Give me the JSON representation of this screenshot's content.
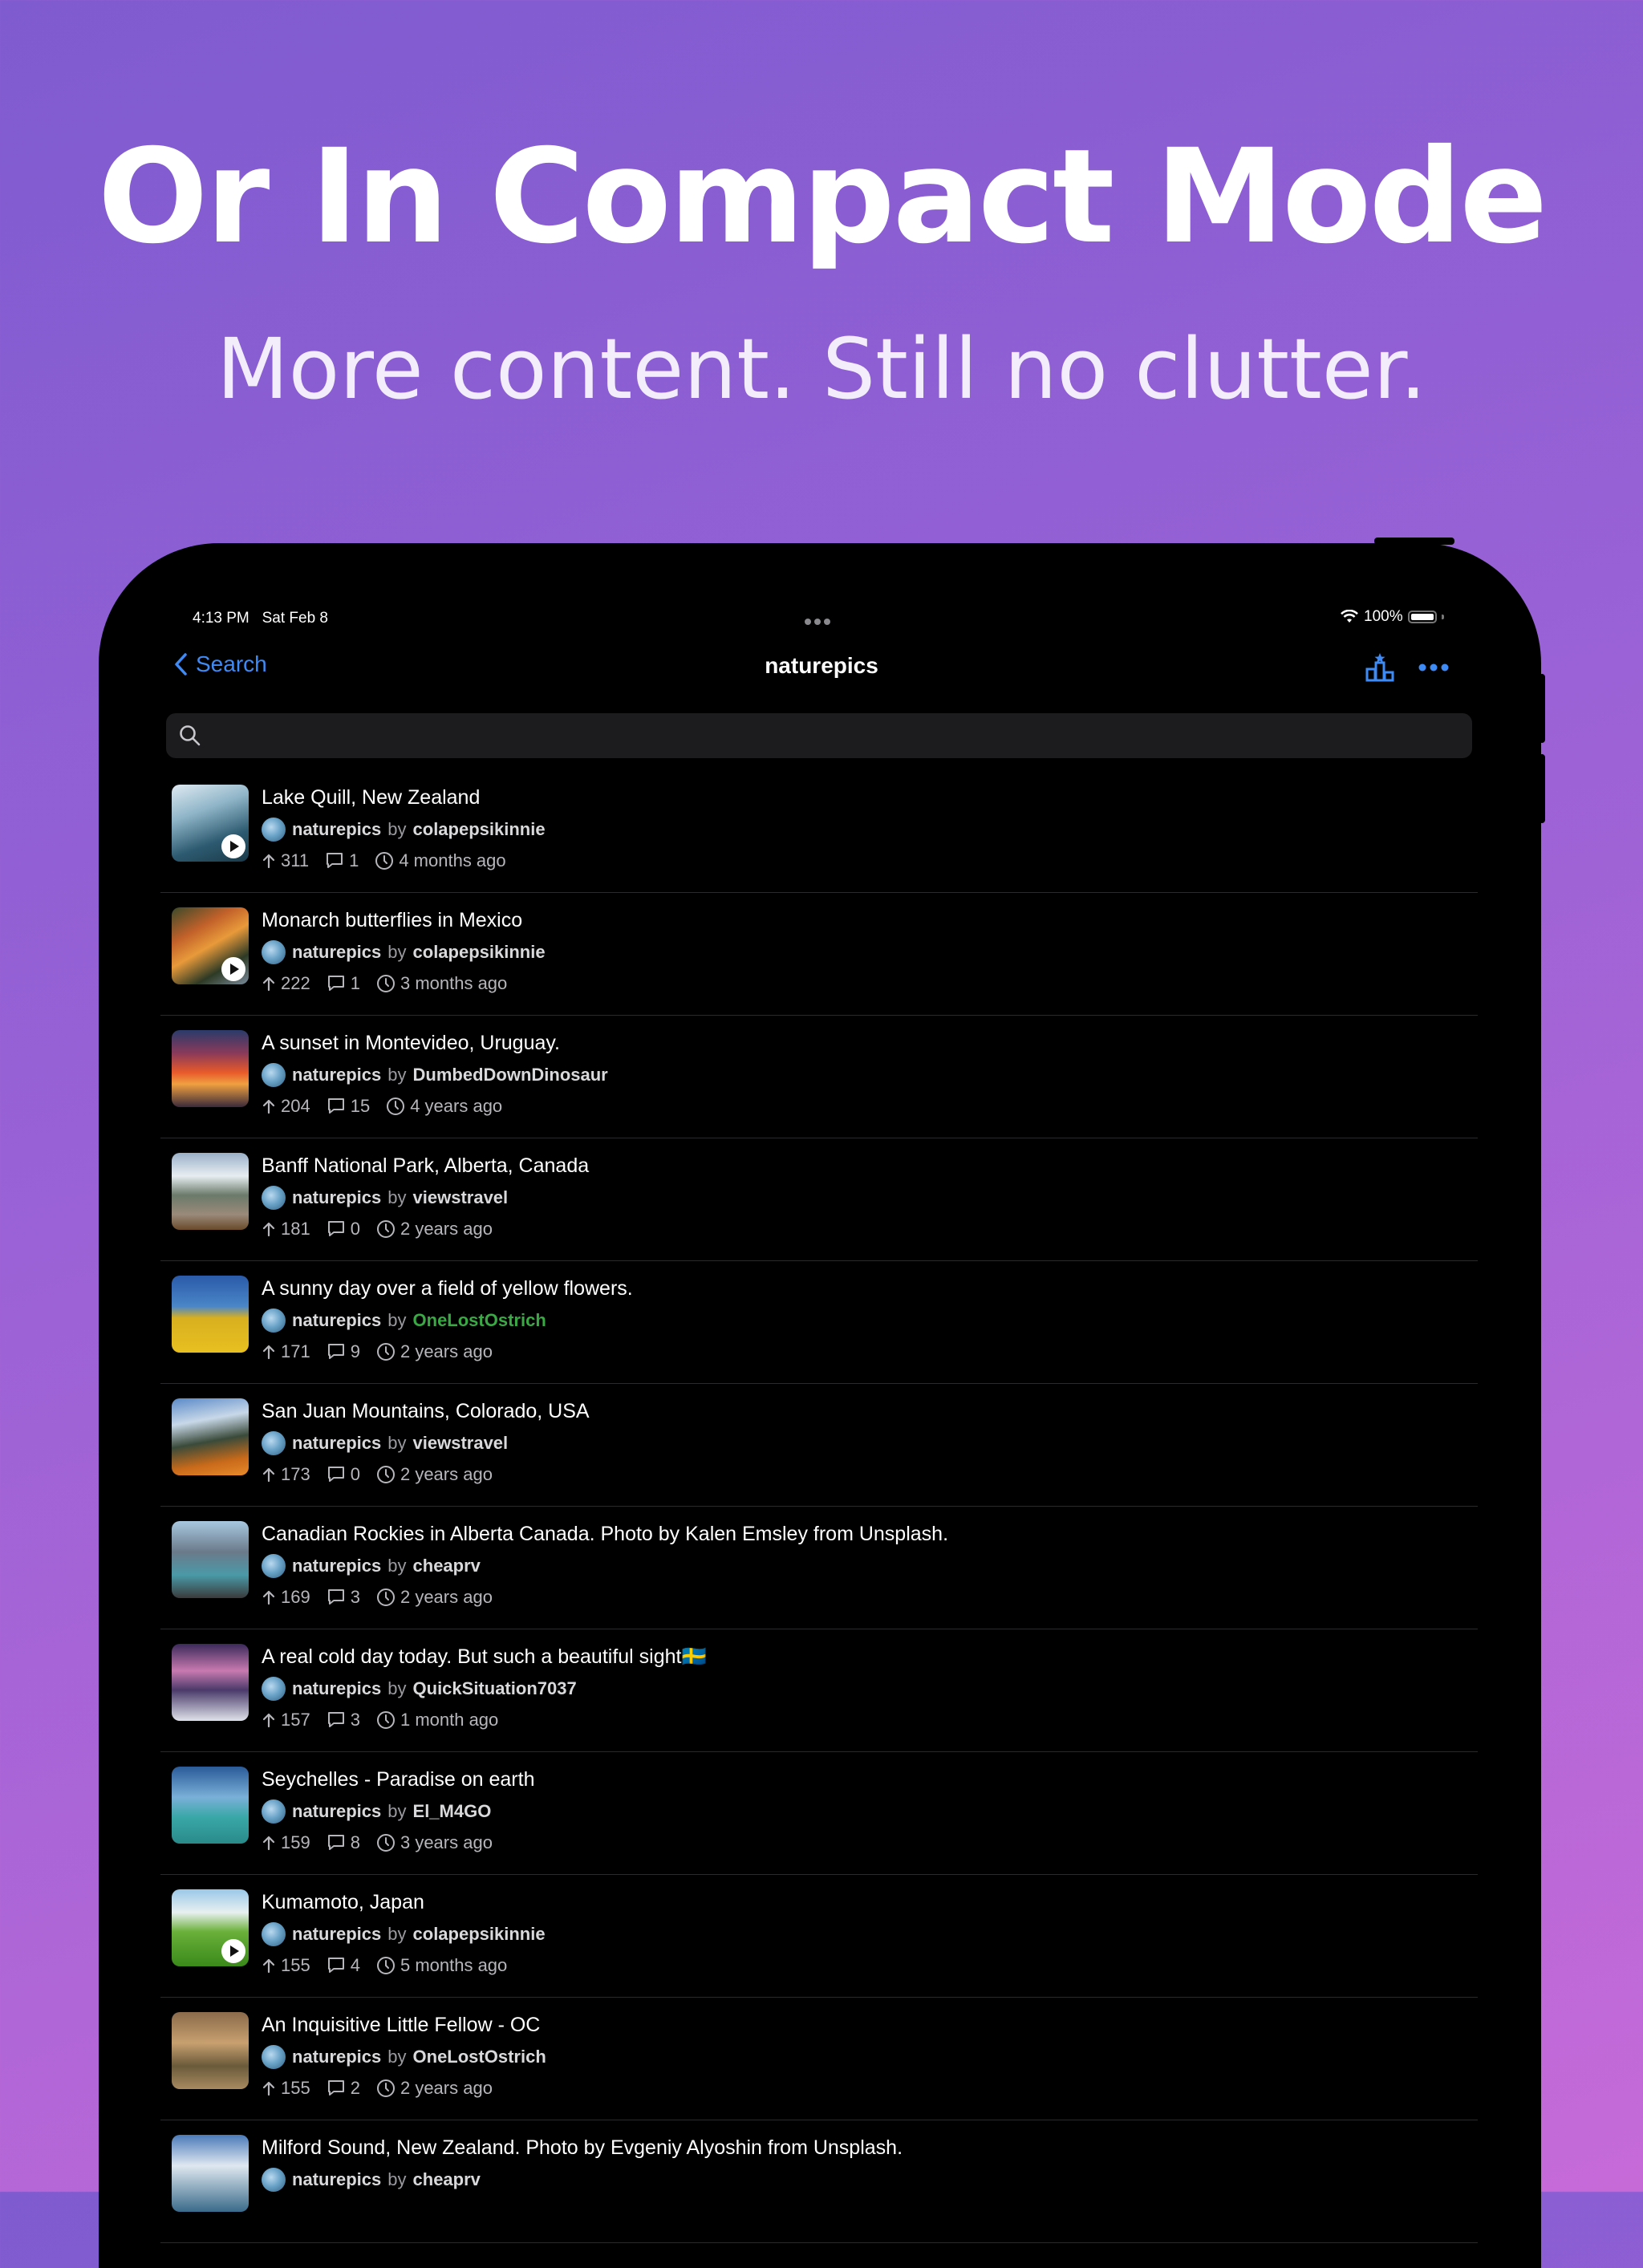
{
  "hero": {
    "title": "Or In Compact Mode",
    "subtitle": "More content. Still no clutter."
  },
  "status_bar": {
    "time": "4:13 PM",
    "date": "Sat Feb 8",
    "battery": "100%"
  },
  "nav": {
    "back_label": "Search",
    "title": "naturepics"
  },
  "search": {
    "value": "",
    "placeholder": ""
  },
  "by_label": "by",
  "posts": [
    {
      "title": "Lake Quill, New Zealand",
      "subreddit": "naturepics",
      "author": "colapepsikinnie",
      "upvotes": "311",
      "comments": "1",
      "age": "4 months ago",
      "video": true,
      "author_color": "default"
    },
    {
      "title": "Monarch butterflies in Mexico",
      "subreddit": "naturepics",
      "author": "colapepsikinnie",
      "upvotes": "222",
      "comments": "1",
      "age": "3 months ago",
      "video": true,
      "author_color": "default"
    },
    {
      "title": "A sunset in Montevideo, Uruguay.",
      "subreddit": "naturepics",
      "author": "DumbedDownDinosaur",
      "upvotes": "204",
      "comments": "15",
      "age": "4 years ago",
      "video": false,
      "author_color": "default"
    },
    {
      "title": "Banff National Park, Alberta, Canada",
      "subreddit": "naturepics",
      "author": "viewstravel",
      "upvotes": "181",
      "comments": "0",
      "age": "2 years ago",
      "video": false,
      "author_color": "default"
    },
    {
      "title": "A sunny day over a field of yellow flowers.",
      "subreddit": "naturepics",
      "author": "OneLostOstrich",
      "upvotes": "171",
      "comments": "9",
      "age": "2 years ago",
      "video": false,
      "author_color": "#3aa845"
    },
    {
      "title": "San Juan Mountains, Colorado, USA",
      "subreddit": "naturepics",
      "author": "viewstravel",
      "upvotes": "173",
      "comments": "0",
      "age": "2 years ago",
      "video": false,
      "author_color": "default"
    },
    {
      "title": "Canadian Rockies in Alberta Canada. Photo by Kalen Emsley from Unsplash.",
      "subreddit": "naturepics",
      "author": "cheaprv",
      "upvotes": "169",
      "comments": "3",
      "age": "2 years ago",
      "video": false,
      "author_color": "default"
    },
    {
      "title": "A real cold day today. But such a beautiful sight🇸🇪",
      "subreddit": "naturepics",
      "author": "QuickSituation7037",
      "upvotes": "157",
      "comments": "3",
      "age": "1 month ago",
      "video": false,
      "author_color": "default"
    },
    {
      "title": "Seychelles - Paradise on earth",
      "subreddit": "naturepics",
      "author": "El_M4GO",
      "upvotes": "159",
      "comments": "8",
      "age": "3 years ago",
      "video": false,
      "author_color": "default"
    },
    {
      "title": "Kumamoto, Japan",
      "subreddit": "naturepics",
      "author": "colapepsikinnie",
      "upvotes": "155",
      "comments": "4",
      "age": "5 months ago",
      "video": true,
      "author_color": "default"
    },
    {
      "title": "An Inquisitive Little Fellow - OC",
      "subreddit": "naturepics",
      "author": "OneLostOstrich",
      "upvotes": "155",
      "comments": "2",
      "age": "2 years ago",
      "video": false,
      "author_color": "default"
    },
    {
      "title": "Milford Sound, New Zealand. Photo by Evgeniy Alyoshin from Unsplash.",
      "subreddit": "naturepics",
      "author": "cheaprv",
      "upvotes": "",
      "comments": "",
      "age": "",
      "video": false,
      "author_color": "default"
    }
  ],
  "colors": {
    "accent": "#3e8bf5",
    "background_gradient_start": "#7f5bd0",
    "background_gradient_end": "#c66ad8",
    "flair_green": "#3aa845"
  },
  "icons": {
    "back": "chevron-left-icon",
    "sort": "leaderboard-icon",
    "more": "ellipsis-icon",
    "search": "magnifier-icon",
    "upvote": "arrow-up-icon",
    "comments": "speech-bubble-icon",
    "age": "clock-icon",
    "video": "play-icon"
  }
}
